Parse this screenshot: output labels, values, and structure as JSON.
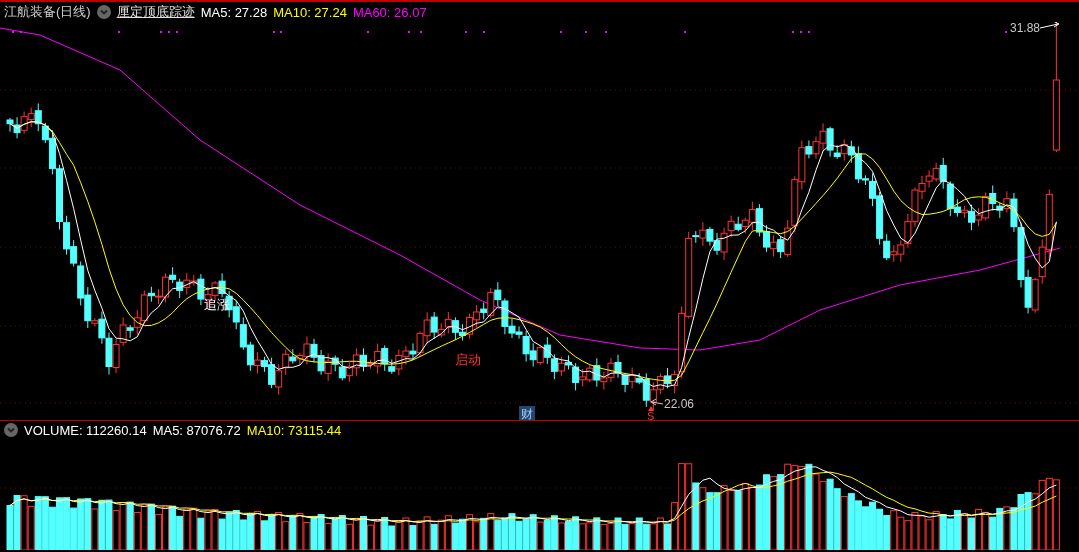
{
  "header": {
    "title": "江航装备(日线)",
    "indicator": "厘定顶底踪迹",
    "readouts": [
      {
        "text": "MA5: 27.28",
        "color": "#ffffff"
      },
      {
        "text": "MA10: 27.24",
        "color": "#ffff00"
      },
      {
        "text": "MA60: 26.07",
        "color": "#ff00ff"
      }
    ]
  },
  "signals": [
    {
      "text": "追涨",
      "color": "#ffffff"
    },
    {
      "text": "启动",
      "color": "#ff3232"
    }
  ],
  "price_high": "31.88",
  "price_low": "22.06",
  "event_badge": "财",
  "sell_mark": "S",
  "volume": {
    "readouts": [
      {
        "text": "VOLUME: 112260.14",
        "color": "#ffffff"
      },
      {
        "text": "MA5: 87076.72",
        "color": "#ffffff"
      },
      {
        "text": "MA10: 73115.44",
        "color": "#ffff00"
      }
    ]
  }
}
